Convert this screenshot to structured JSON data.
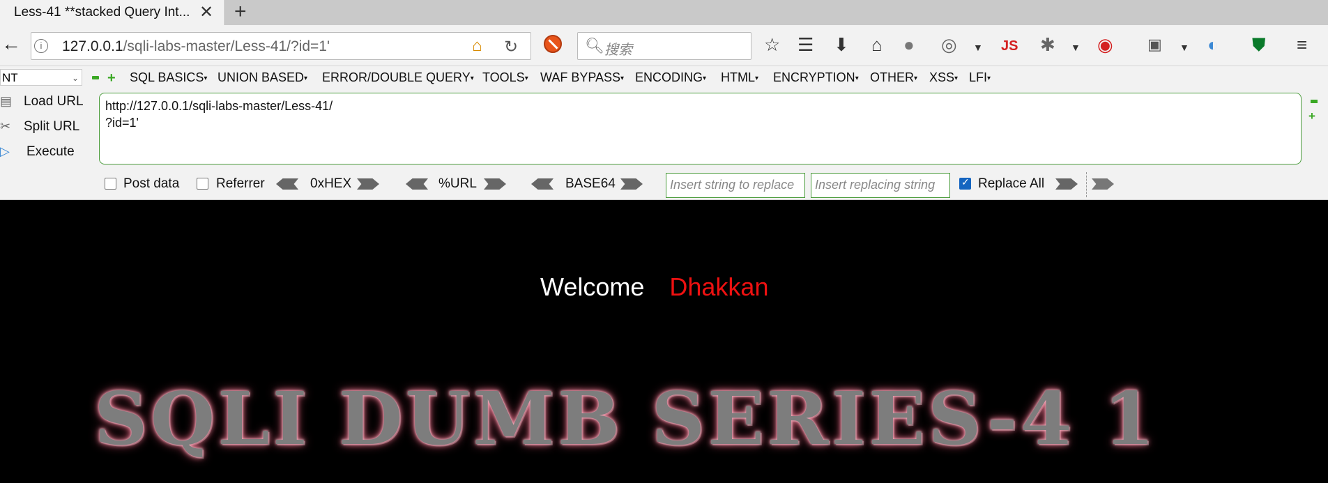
{
  "tab": {
    "title": "Less-41 **stacked Query Int...",
    "close": "✕",
    "new_tab": "+"
  },
  "nav": {
    "url_host": "127.0.0.1",
    "url_path": "/sqli-labs-master/Less-41/?id=1'",
    "search_placeholder": "搜索"
  },
  "hackbar": {
    "select_value": "NT",
    "menus": [
      "SQL BASICS",
      "UNION BASED",
      "ERROR/DOUBLE QUERY",
      "TOOLS",
      "WAF BYPASS",
      "ENCODING",
      "HTML",
      "ENCRYPTION",
      "OTHER",
      "XSS",
      "LFI"
    ],
    "load_url": "Load URL",
    "split_url": "Split URL",
    "execute": "Execute",
    "url_value": "http://127.0.0.1/sqli-labs-master/Less-41/\n?id=1'",
    "post_data": "Post data",
    "referrer": "Referrer",
    "hex": "0xHEX",
    "url_enc": "%URL",
    "base64": "BASE64",
    "replace_placeholder": "Insert string to replace",
    "replacing_placeholder": "Insert replacing string",
    "replace_all": "Replace All",
    "replace_all_checked": true
  },
  "page": {
    "welcome": "Welcome",
    "name": "Dhakkan",
    "banner": "SQLI DUMB SERIES-4 1"
  }
}
